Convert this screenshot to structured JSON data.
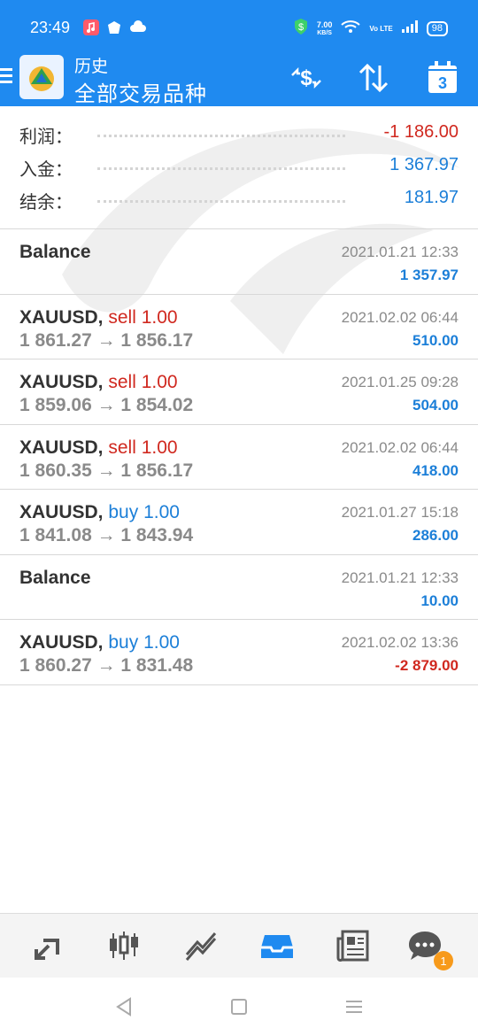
{
  "status_bar": {
    "time": "23:49",
    "speed_value": "7.00",
    "speed_unit": "KB/S",
    "volte": "Vo LTE",
    "battery": "98"
  },
  "app_bar": {
    "title": "历史",
    "subtitle": "全部交易品种",
    "calendar_day": "3"
  },
  "summary": [
    {
      "label": "利润：",
      "value": "-1 186.00",
      "tone": "neg"
    },
    {
      "label": "入金：",
      "value": "1 367.97",
      "tone": "pos"
    },
    {
      "label": "结余：",
      "value": "181.97",
      "tone": "pos"
    }
  ],
  "history": [
    {
      "symbol": "Balance",
      "side": "",
      "volume": "",
      "prices": "",
      "date": "2021.01.21 12:33",
      "profit": "1 357.97",
      "tone": "pos"
    },
    {
      "symbol": "XAUUSD,",
      "side": "sell",
      "volume": "1.00",
      "prices": "1 861.27 → 1 856.17",
      "date": "2021.02.02 06:44",
      "profit": "510.00",
      "tone": "pos"
    },
    {
      "symbol": "XAUUSD,",
      "side": "sell",
      "volume": "1.00",
      "prices": "1 859.06 → 1 854.02",
      "date": "2021.01.25 09:28",
      "profit": "504.00",
      "tone": "pos"
    },
    {
      "symbol": "XAUUSD,",
      "side": "sell",
      "volume": "1.00",
      "prices": "1 860.35 → 1 856.17",
      "date": "2021.02.02 06:44",
      "profit": "418.00",
      "tone": "pos"
    },
    {
      "symbol": "XAUUSD,",
      "side": "buy",
      "volume": "1.00",
      "prices": "1 841.08 → 1 843.94",
      "date": "2021.01.27 15:18",
      "profit": "286.00",
      "tone": "pos"
    },
    {
      "symbol": "Balance",
      "side": "",
      "volume": "",
      "prices": "",
      "date": "2021.01.21 12:33",
      "profit": "10.00",
      "tone": "pos"
    },
    {
      "symbol": "XAUUSD,",
      "side": "buy",
      "volume": "1.00",
      "prices": "1 860.27 → 1 831.48",
      "date": "2021.02.02 13:36",
      "profit": "-2 879.00",
      "tone": "neg"
    }
  ],
  "tab_bar": {
    "tabs": [
      {
        "icon": "trade-arrows-icon"
      },
      {
        "icon": "candlestick-chart-icon"
      },
      {
        "icon": "trending-line-icon"
      },
      {
        "icon": "history-inbox-icon",
        "active": true
      },
      {
        "icon": "news-icon"
      },
      {
        "icon": "chat-icon",
        "badge": "1"
      }
    ]
  },
  "colors": {
    "brand": "#1f8af0",
    "profit_positive": "#1c7fd8",
    "profit_negative": "#d0281f",
    "badge": "#f79a1b"
  }
}
